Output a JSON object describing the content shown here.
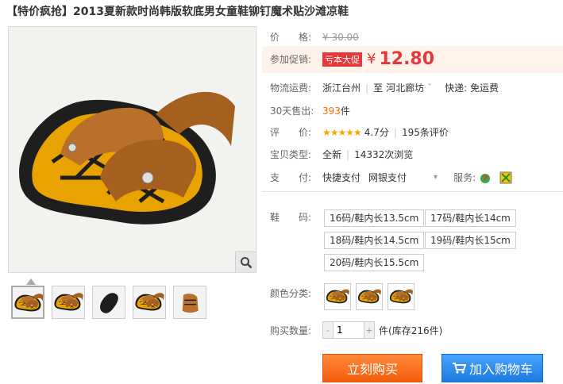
{
  "title": "【特价疯抢】2013夏新款时尚韩版软底男女童鞋铆钉魔术贴沙滩凉鞋",
  "price": {
    "label": "价　　格:",
    "original": "¥ 30.00"
  },
  "promo": {
    "label": "参加促销:",
    "tag": "亏本大促",
    "currency": "¥",
    "price": "12.80"
  },
  "shipping": {
    "label": "物流运费:",
    "from": "浙江台州",
    "to_prefix": "至",
    "to": "河北廊坊",
    "dropdown": "ˇ",
    "method": "快递: 免运费"
  },
  "sales": {
    "label": "30天售出:",
    "count": "393",
    "unit": "件"
  },
  "rating": {
    "label": "评　　价:",
    "stars": "★★★★★",
    "score": "4.7分",
    "reviews": "195条评价"
  },
  "type": {
    "label": "宝贝类型:",
    "condition": "全新",
    "views": "14332次浏览"
  },
  "payment": {
    "label": "支　　付:",
    "methods": [
      "快捷支付",
      "网银支付"
    ],
    "service_label": "服务:"
  },
  "sizes": {
    "label": "鞋　　码:",
    "options": [
      "16码/鞋内长13.5cm",
      "17码/鞋内长14cm",
      "18码/鞋内长14.5cm",
      "19码/鞋内长15cm",
      "20码/鞋内长15.5cm"
    ]
  },
  "colors": {
    "label": "颜色分类:"
  },
  "quantity": {
    "label": "购买数量:",
    "value": "1",
    "minus": "-",
    "plus": "+",
    "unit": "件",
    "stock": "(库存216件)"
  },
  "buttons": {
    "buy": "立刻购买",
    "cart": "加入购物车"
  },
  "colors_theme": {
    "accent": "#e4393c",
    "buy": "#f45d0a",
    "cart": "#1a7be0"
  }
}
